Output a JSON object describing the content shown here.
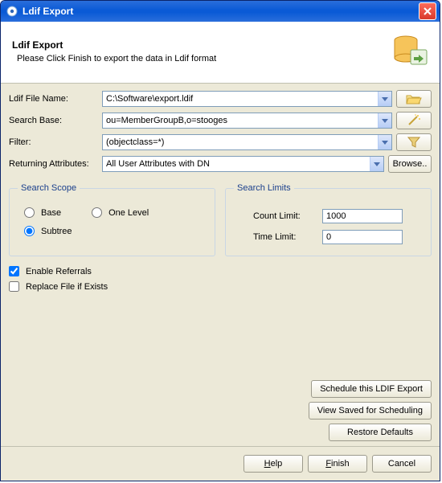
{
  "window": {
    "title": "Ldif Export"
  },
  "header": {
    "title": "Ldif Export",
    "subtitle": "Please Click Finish to export the data in Ldif format"
  },
  "form": {
    "filename_label": "Ldif File Name:",
    "filename_value": "C:\\Software\\export.ldif",
    "searchbase_label": "Search Base:",
    "searchbase_value": "ou=MemberGroupB,o=stooges",
    "filter_label": "Filter:",
    "filter_value": "(objectclass=*)",
    "attrs_label": "Returning Attributes:",
    "attrs_value": "All User Attributes with DN",
    "browse_label": "Browse.."
  },
  "scope": {
    "legend": "Search Scope",
    "base": "Base",
    "one_level": "One Level",
    "subtree": "Subtree",
    "selected": "subtree"
  },
  "limits": {
    "legend": "Search Limits",
    "count_label": "Count Limit:",
    "count_value": "1000",
    "time_label": "Time Limit:",
    "time_value": "0"
  },
  "checks": {
    "referrals": "Enable Referrals",
    "referrals_checked": true,
    "replace": "Replace File if Exists",
    "replace_checked": false
  },
  "buttons": {
    "schedule": "Schedule this LDIF Export",
    "view_saved": "View Saved for Scheduling",
    "restore": "Restore Defaults",
    "help": "Help",
    "finish": "Finish",
    "cancel": "Cancel"
  }
}
